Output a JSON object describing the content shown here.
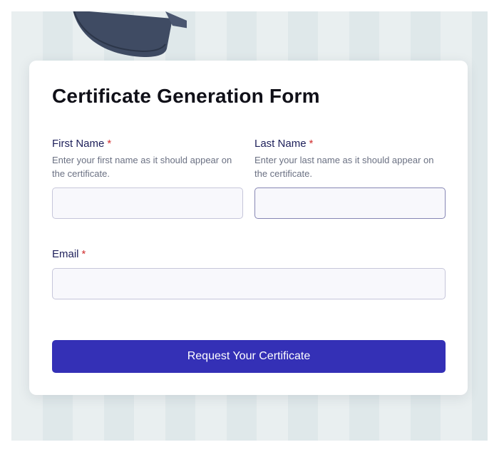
{
  "form": {
    "title": "Certificate Generation Form",
    "first_name": {
      "label": "First Name",
      "required_mark": "*",
      "help": "Enter your first name as it should appear on the certificate.",
      "value": ""
    },
    "last_name": {
      "label": "Last Name",
      "required_mark": "*",
      "help": "Enter your last name as it should appear on the certificate.",
      "value": ""
    },
    "email": {
      "label": "Email",
      "required_mark": "*",
      "value": ""
    },
    "submit_label": "Request Your Certificate"
  },
  "colors": {
    "accent": "#3430b6",
    "required": "#d12f2f",
    "label": "#1d1f5a"
  },
  "decor": {
    "background_icon": "graduation-cap-icon"
  }
}
